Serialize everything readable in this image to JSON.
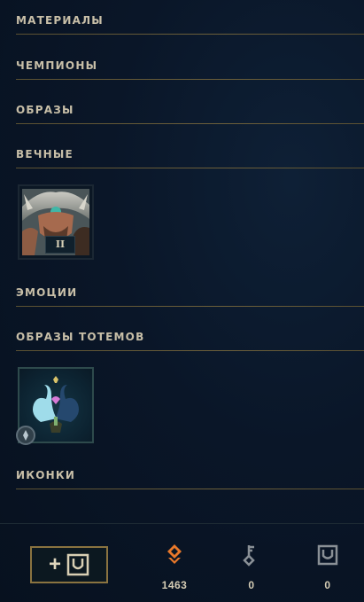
{
  "sections": {
    "materials": "МАТЕРИАЛЫ",
    "champions": "ЧЕМПИОНЫ",
    "skins": "ОБРАЗЫ",
    "eternals": "ВЕЧНЫЕ",
    "emotes": "ЭМОЦИИ",
    "ward_skins": "ОБРАЗЫ ТОТЕМОВ",
    "icons": "ИКОНКИ"
  },
  "eternals_tile": {
    "level": "II"
  },
  "footer": {
    "currencies": [
      {
        "icon": "orange-essence-icon",
        "value": "1463",
        "color": "#e8782a"
      },
      {
        "icon": "key-icon",
        "value": "0",
        "color": "#8a9096"
      },
      {
        "icon": "chest-icon",
        "value": "0",
        "color": "#8a9096"
      }
    ],
    "add_button_plus": "+"
  }
}
